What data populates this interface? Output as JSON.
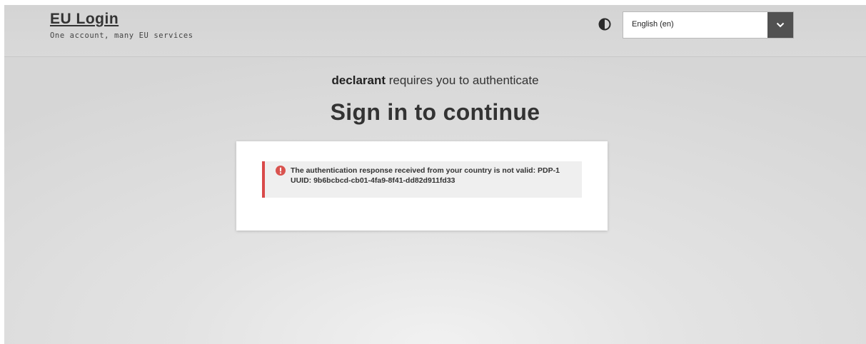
{
  "header": {
    "logo_title": "EU Login",
    "logo_subtitle": "One account, many EU services",
    "contrast_icon": "half-circle-contrast-icon",
    "language": {
      "selected": "English (en)",
      "arrow_icon": "chevron-down-icon"
    }
  },
  "main": {
    "requires": {
      "service": "declarant",
      "text": " requires you to authenticate"
    },
    "title": "Sign in to continue",
    "alert": {
      "icon": "exclamation-circle-icon",
      "message": "The authentication response received from your country is not valid: PDP-1 UUID: 9b6bcbcd-cb01-4fa9-8f41-dd82d911fd33"
    }
  },
  "colors": {
    "alert_border": "#d94a4a",
    "alert_icon": "#d9534f",
    "dropdown_button": "#515151",
    "alert_background": "#efefef"
  }
}
